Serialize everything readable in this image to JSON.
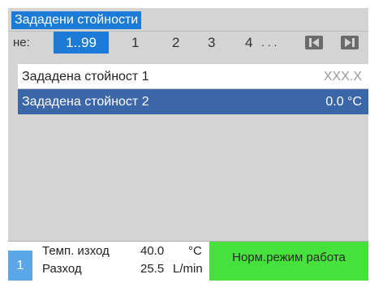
{
  "header": {
    "title": "Зададени стойности"
  },
  "nav": {
    "label": "не:",
    "range": "1..99",
    "pages": [
      "1",
      "2",
      "3",
      "4",
      ". . ."
    ]
  },
  "list": [
    {
      "label": "Зададена стойност 1",
      "value": "XXX.X"
    },
    {
      "label": "Зададена стойност 2",
      "value": "0.0 °C"
    }
  ],
  "status": {
    "channel": "1",
    "temp_label": "Темп. изход",
    "temp_value": "40.0",
    "temp_unit": "°C",
    "flow_label": "Разход",
    "flow_value": "25.5",
    "flow_unit": "L/min",
    "mode": "Норм.режим работа"
  },
  "colors": {
    "accent": "#1c7bd6",
    "selected_row": "#3b67a8",
    "mode_green": "#46e13c",
    "channel_badge": "#5aa6e6"
  },
  "icons": {
    "prev": "skip-back-icon",
    "next": "skip-forward-icon"
  }
}
